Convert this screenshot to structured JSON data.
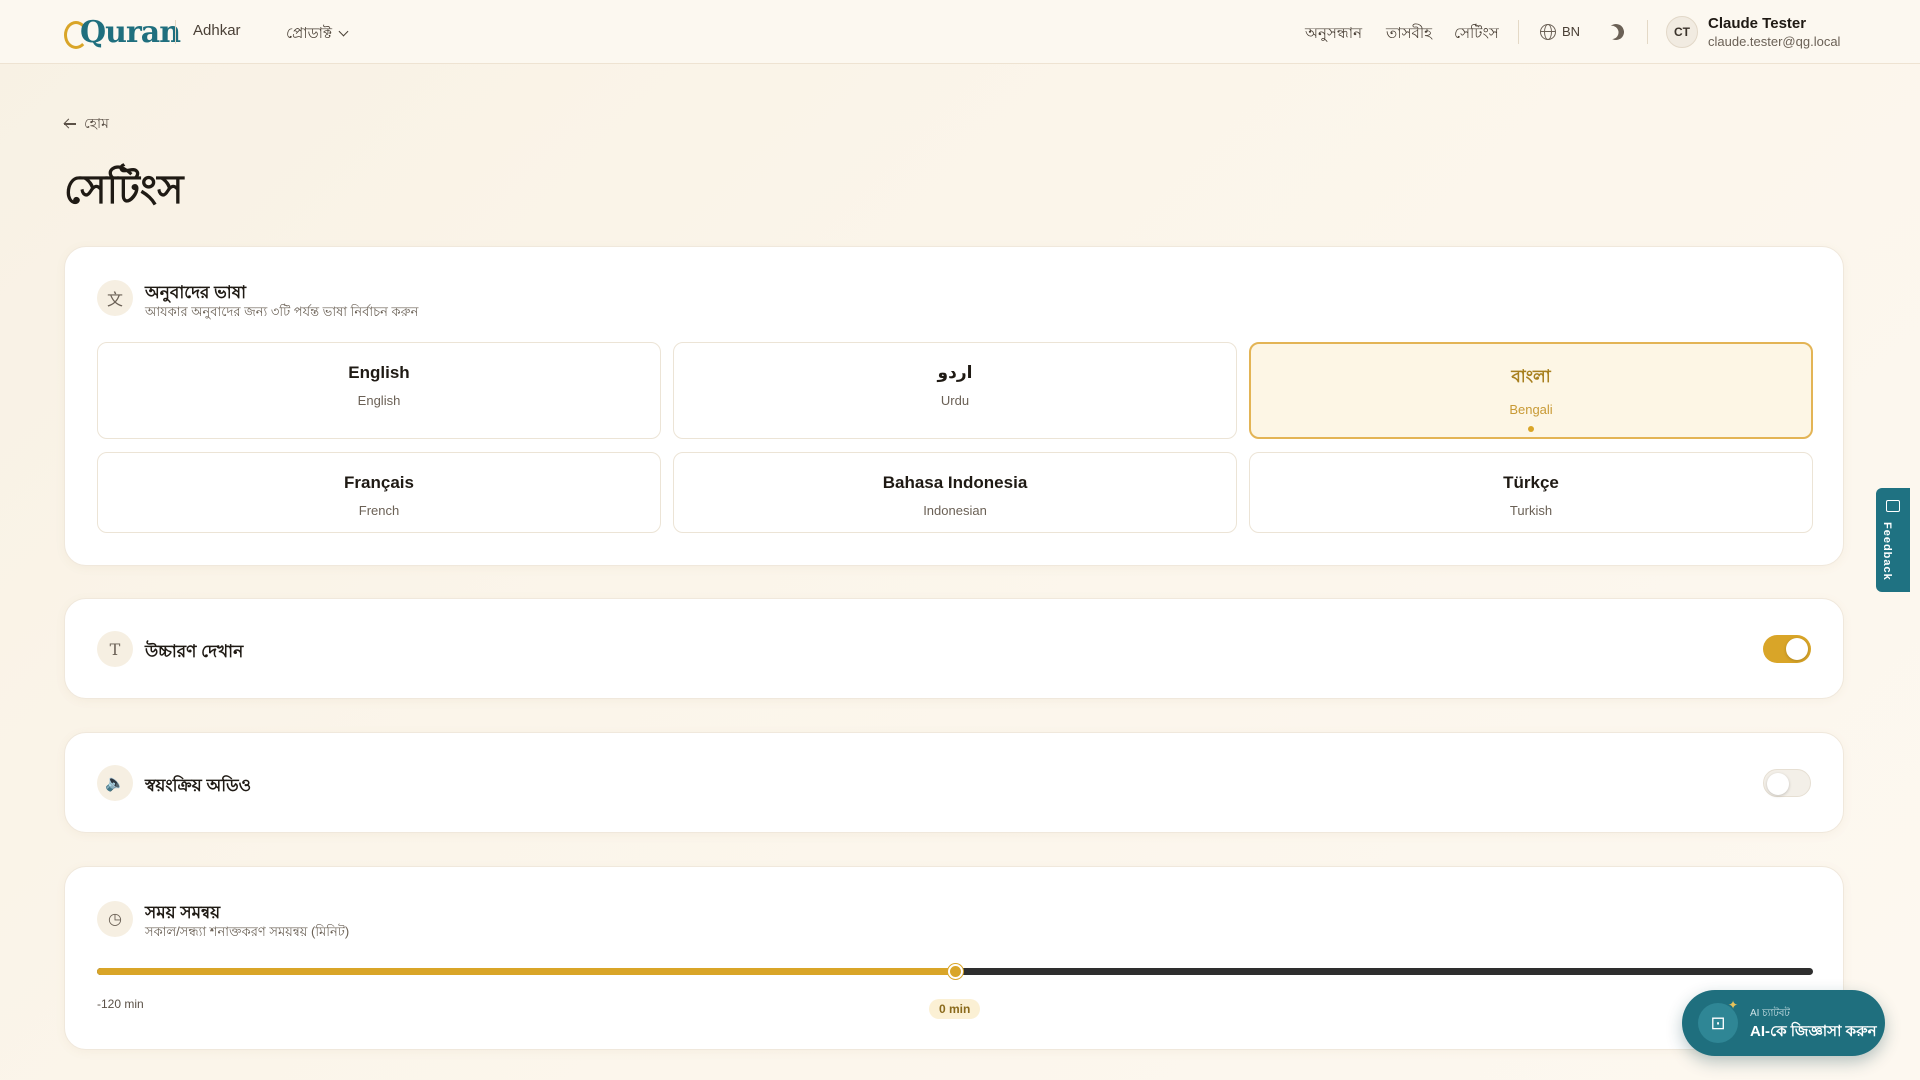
{
  "header": {
    "logo_text": "Quran",
    "nav": {
      "adhkar": "Adhkar",
      "products": "প্রোডাক্ট",
      "search": "অনুসন্ধান",
      "tasbih": "তাসবীহ",
      "settings": "সেটিংস"
    },
    "language_code": "BN",
    "user": {
      "initials": "CT",
      "name": "Claude Tester",
      "email": "claude.tester@qg.local"
    }
  },
  "page": {
    "back_label": "হোম",
    "title": "সেটিংস"
  },
  "translation": {
    "title": "অনুবাদের ভাষা",
    "subtitle": "আযকার অনুবাদের জন্য ৩টি পর্যন্ত ভাষা নির্বাচন করুন",
    "languages": [
      {
        "name": "English",
        "native": "English",
        "selected": false
      },
      {
        "name": "اردو",
        "native": "Urdu",
        "selected": false
      },
      {
        "name": "বাংলা",
        "native": "Bengali",
        "selected": true
      },
      {
        "name": "Français",
        "native": "French",
        "selected": false
      },
      {
        "name": "Bahasa Indonesia",
        "native": "Indonesian",
        "selected": false
      },
      {
        "name": "Türkçe",
        "native": "Turkish",
        "selected": false
      }
    ]
  },
  "pronunciation": {
    "title": "উচ্চারণ দেখান",
    "enabled": true
  },
  "autoplay": {
    "title": "স্বয়ংক্রিয় অডিও",
    "enabled": false
  },
  "timing": {
    "title": "সময় সমন্বয়",
    "subtitle": "সকাল/সন্ধ্যা শনাক্তকরণ সময়ন্বয় (মিনিট)",
    "min_label": "-120 min",
    "value_label": "0 min",
    "min": -120,
    "max": 120,
    "value": 0
  },
  "feedback_label": "Feedback",
  "ai_chat": {
    "small_label": "AI চ্যাটবট",
    "main_label": "AI-কে জিজ্ঞাসা করুন"
  },
  "colors": {
    "accent": "#d9a528",
    "brand": "#1f6f7e"
  }
}
